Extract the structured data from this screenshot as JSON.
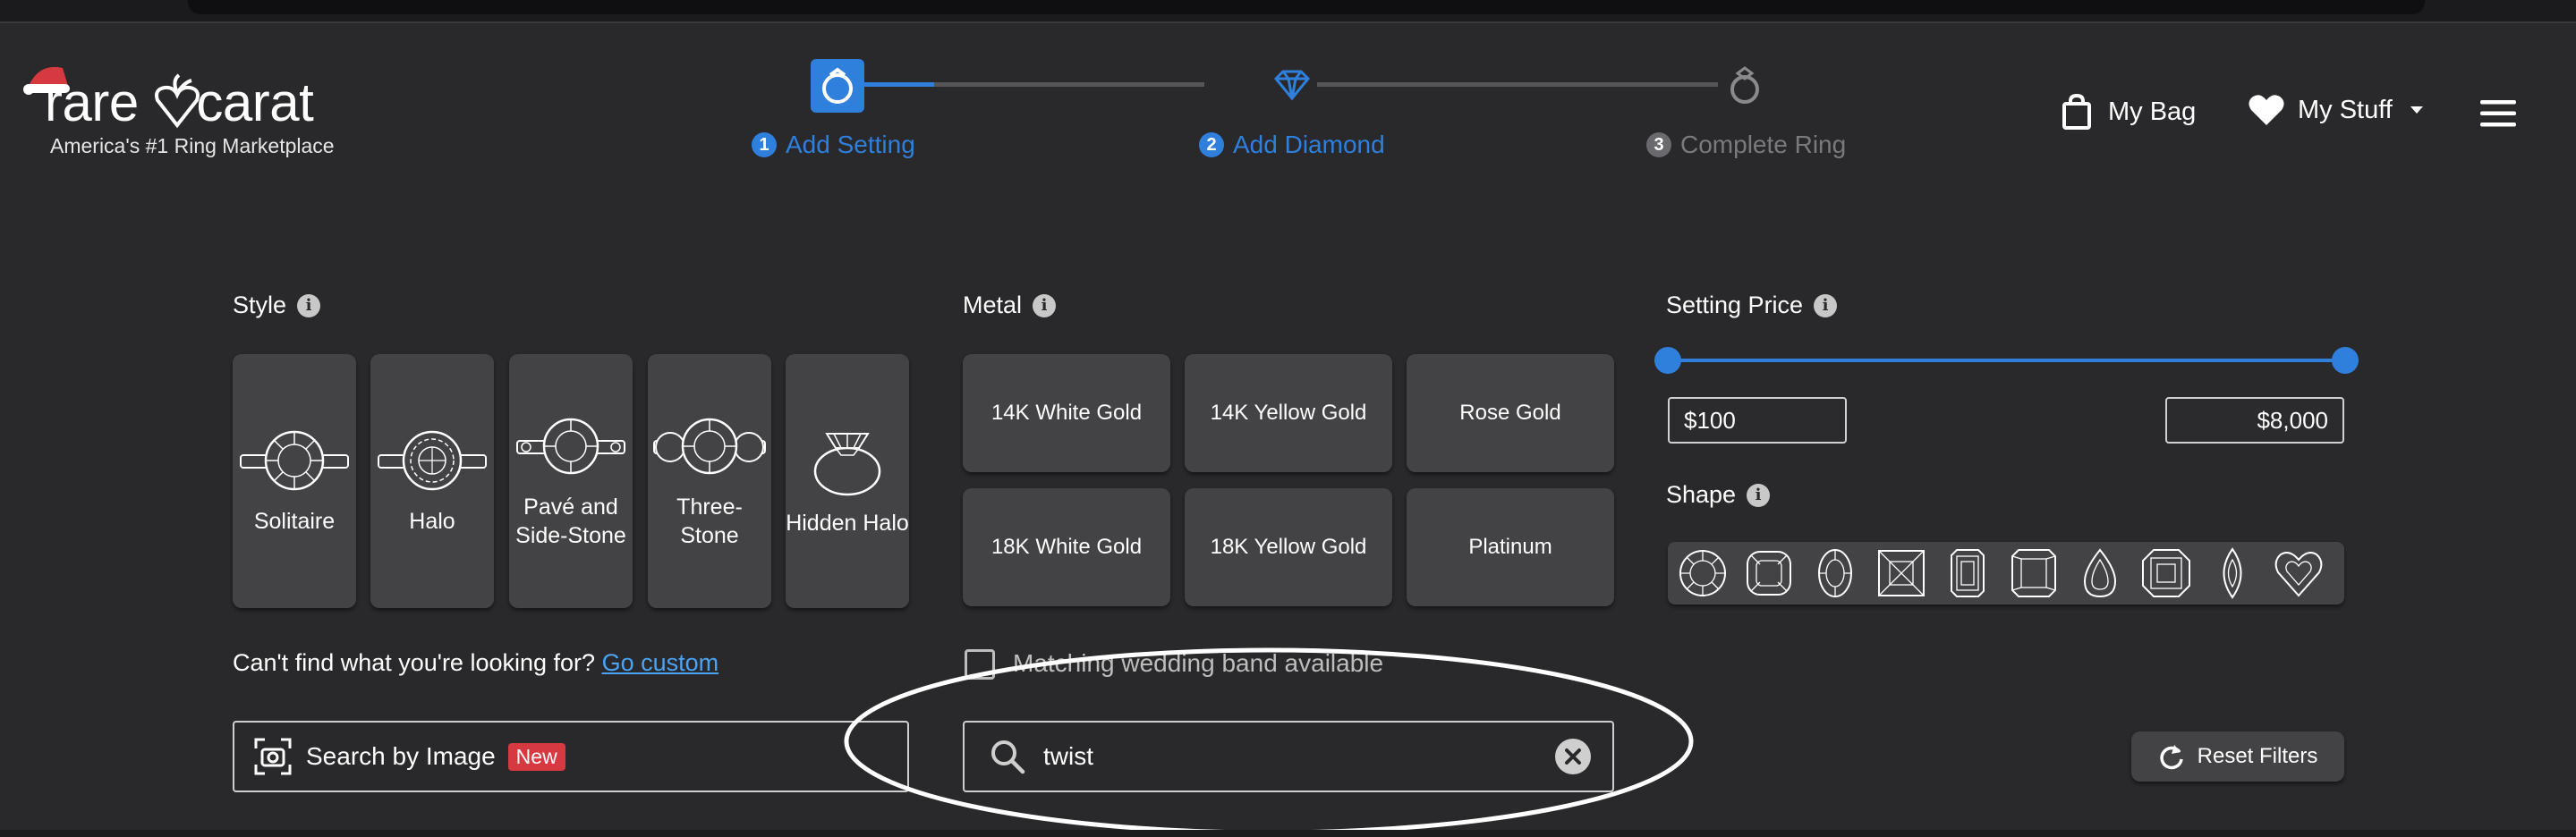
{
  "header": {
    "logo_text": "rare carat",
    "tagline": "America's #1 Ring Marketplace",
    "steps": [
      {
        "num": "1",
        "label": "Add Setting",
        "state": "active"
      },
      {
        "num": "2",
        "label": "Add Diamond",
        "state": "next"
      },
      {
        "num": "3",
        "label": "Complete Ring",
        "state": "inactive"
      }
    ],
    "bag_label": "My Bag",
    "stuff_label": "My Stuff",
    "colors": {
      "accent": "#2f7fdc",
      "inactive": "#7a7a7e"
    }
  },
  "filters": {
    "style": {
      "title": "Style",
      "options": [
        "Solitaire",
        "Halo",
        "Pavé and Side-Stone",
        "Three-Stone",
        "Hidden Halo"
      ]
    },
    "metal": {
      "title": "Metal",
      "options": [
        "14K White Gold",
        "14K Yellow Gold",
        "Rose Gold",
        "18K White Gold",
        "18K Yellow Gold",
        "Platinum"
      ]
    },
    "price": {
      "title": "Setting Price",
      "min": "$100",
      "max": "$8,000",
      "range_fraction": [
        0,
        1
      ]
    },
    "shape": {
      "title": "Shape",
      "options": [
        "round-icon",
        "cushion-icon",
        "oval-icon",
        "princess-icon",
        "emerald-icon",
        "radiant-icon",
        "pear-icon",
        "asscher-icon",
        "marquise-icon",
        "heart-icon"
      ]
    },
    "cant_find_text": "Can't find what you're looking for?",
    "go_custom": "Go custom",
    "matching_band_label": "Matching wedding band available",
    "search_image_label": "Search by Image",
    "new_badge": "New",
    "search_value": "twist",
    "reset_label": "Reset Filters"
  }
}
